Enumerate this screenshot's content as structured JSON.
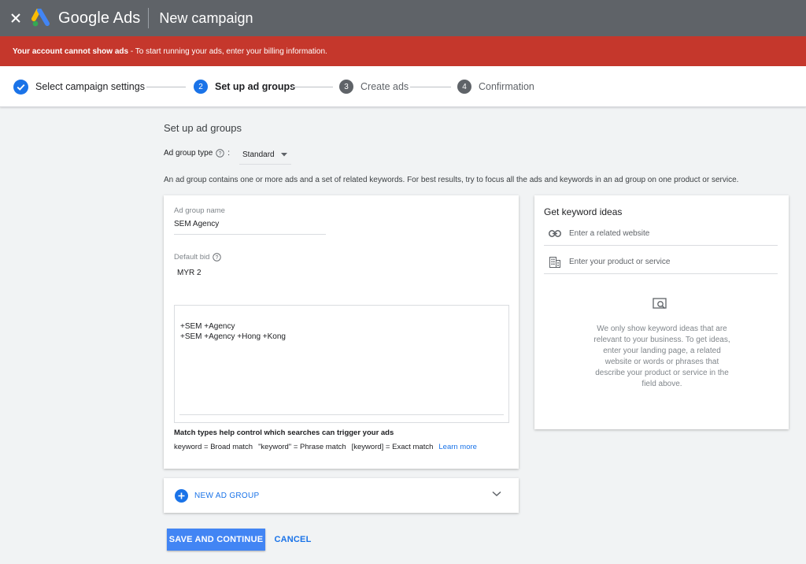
{
  "app": {
    "brand": "Google Ads",
    "page_title": "New campaign"
  },
  "alert": {
    "bold": "Your account cannot show ads",
    "rest": " - To start running your ads, enter your billing information."
  },
  "stepper": {
    "steps": [
      {
        "label": "Select campaign settings",
        "state": "done"
      },
      {
        "num": "2",
        "label": "Set up ad groups",
        "state": "active"
      },
      {
        "num": "3",
        "label": "Create ads",
        "state": "pending"
      },
      {
        "num": "4",
        "label": "Confirmation",
        "state": "pending"
      }
    ]
  },
  "main": {
    "title": "Set up ad groups",
    "ad_group_type_label": "Ad group type",
    "ad_group_type_colon": ":",
    "ad_group_type_value": "Standard",
    "description": "An ad group contains one or more ads and a set of related keywords. For best results, try to focus all the ads and keywords in an ad group on one product or service."
  },
  "ad_group": {
    "name_label": "Ad group name",
    "name_value": "SEM Agency",
    "bid_label": "Default bid",
    "bid_value": "MYR 2",
    "keywords": "+SEM +Agency\n+SEM +Agency +Hong +Kong",
    "match_title": "Match types help control which searches can trigger your ads",
    "match_broad": "keyword = Broad match",
    "match_phrase": "\"keyword\" = Phrase match",
    "match_exact": "[keyword] = Exact match",
    "learn_more": "Learn more"
  },
  "keyword_ideas": {
    "title": "Get keyword ideas",
    "website_placeholder": "Enter a related website",
    "product_placeholder": "Enter your product or service",
    "empty_text": "We only show keyword ideas that are relevant to your business. To get ideas, enter your landing page, a related website or words or phrases that describe your product or service in the field above."
  },
  "new_group": {
    "label": "NEW AD GROUP"
  },
  "actions": {
    "save": "SAVE AND CONTINUE",
    "cancel": "CANCEL"
  },
  "colors": {
    "appbar": "#5f6368",
    "alert": "#c5372c",
    "accent": "#1a73e8",
    "primary_button": "#4285f4"
  }
}
